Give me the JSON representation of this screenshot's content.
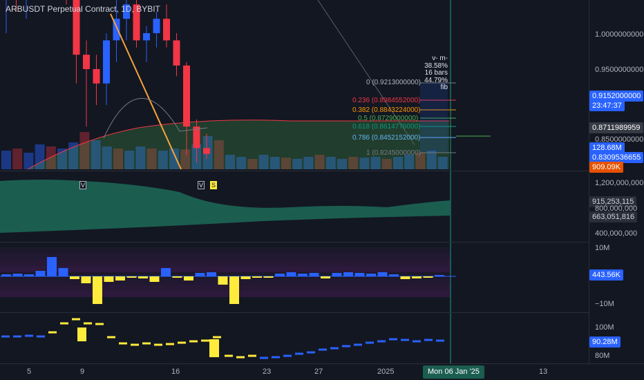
{
  "symbol": {
    "title": "ARBUSDT Perpetual Contract, 1D, BYBIT"
  },
  "price_axis": {
    "ticks": [
      "1.0000000000",
      "0.9500000000",
      "0.8500000000"
    ],
    "tags": {
      "current_price": "0.9152000000",
      "countdown": "23:47:37",
      "ma_value": "0.8711989959",
      "volume": "128.68M",
      "level_low": "0.8309536655",
      "volume_red": "909.09K"
    }
  },
  "fib": {
    "levels": [
      {
        "label": "0 (0.9213000000)",
        "color": "#787b86"
      },
      {
        "label": "0.236 (0.8984552000)",
        "color": "#f23645"
      },
      {
        "label": "0.382 (0.8843224000)",
        "color": "#ff9800"
      },
      {
        "label": "0.5 (0.8729000000)",
        "color": "#4caf50"
      },
      {
        "label": "0.618 (0.8614776000)",
        "color": "#089981"
      },
      {
        "label": "0.786 (0.8452152000)",
        "color": "#64b5f6"
      },
      {
        "label": "1 (0.8245000000)",
        "color": "#787b86"
      }
    ]
  },
  "measure_box": {
    "line1": "v- m-",
    "line2": "38.58%",
    "line3": "16 bars",
    "line4": "44.79% fib"
  },
  "markers": {
    "m1": "V",
    "m2": "V",
    "m3": "S"
  },
  "oscillator_axis": {
    "ticks": [
      "1,200,000,000",
      "800,000,000",
      "400,000,000"
    ],
    "tags": {
      "value_a": "915,253,115",
      "value_b": "663,051,816"
    }
  },
  "delta_axis": {
    "ticks": [
      "10M",
      "−10M"
    ],
    "tag": "443.56K"
  },
  "volume_axis": {
    "ticks": [
      "100M",
      "80M"
    ],
    "tag": "90.28M"
  },
  "time_axis": {
    "ticks": [
      "5",
      "9",
      "16",
      "23",
      "27",
      "2025",
      "13"
    ],
    "cursor_label": "Mon 06 Jan '25"
  },
  "colors": {
    "up": "#2962ff",
    "down": "#f23645",
    "delta_pos": "#2962ff",
    "delta_neg": "#ffeb3b",
    "area": "#1b5e50",
    "cursor": "#1b9e84",
    "trendline": "#f7a43b"
  },
  "chart_data": {
    "type": "candlestick",
    "title": "ARBUSDT Perpetual Contract, 1D, BYBIT",
    "candles": [
      {
        "o": 1.05,
        "h": 1.09,
        "l": 1.0,
        "c": 1.07
      },
      {
        "o": 1.07,
        "h": 1.1,
        "l": 1.03,
        "c": 1.06
      },
      {
        "o": 1.06,
        "h": 1.1,
        "l": 1.02,
        "c": 1.08
      },
      {
        "o": 1.08,
        "h": 1.12,
        "l": 1.05,
        "c": 1.1
      },
      {
        "o": 1.1,
        "h": 1.14,
        "l": 1.08,
        "c": 1.12
      },
      {
        "o": 1.12,
        "h": 1.15,
        "l": 1.1,
        "c": 1.13
      },
      {
        "o": 1.13,
        "h": 1.14,
        "l": 1.04,
        "c": 1.05
      },
      {
        "o": 1.05,
        "h": 1.07,
        "l": 0.93,
        "c": 0.97
      },
      {
        "o": 0.97,
        "h": 0.99,
        "l": 0.87,
        "c": 0.95
      },
      {
        "o": 0.95,
        "h": 0.97,
        "l": 0.9,
        "c": 0.93
      },
      {
        "o": 0.93,
        "h": 1.0,
        "l": 0.9,
        "c": 0.99
      },
      {
        "o": 0.99,
        "h": 1.05,
        "l": 0.96,
        "c": 1.02
      },
      {
        "o": 1.02,
        "h": 1.06,
        "l": 0.99,
        "c": 1.04
      },
      {
        "o": 1.04,
        "h": 1.06,
        "l": 0.98,
        "c": 0.99
      },
      {
        "o": 0.99,
        "h": 1.01,
        "l": 0.96,
        "c": 1.0
      },
      {
        "o": 1.0,
        "h": 1.03,
        "l": 0.98,
        "c": 1.02
      },
      {
        "o": 1.02,
        "h": 1.04,
        "l": 0.98,
        "c": 0.99
      },
      {
        "o": 0.99,
        "h": 1.0,
        "l": 0.94,
        "c": 0.955
      },
      {
        "o": 0.955,
        "h": 0.96,
        "l": 0.83,
        "c": 0.87
      },
      {
        "o": 0.87,
        "h": 0.88,
        "l": 0.82,
        "c": 0.84
      },
      {
        "o": 0.84,
        "h": 0.86,
        "l": 0.825,
        "c": 0.832
      }
    ]
  }
}
